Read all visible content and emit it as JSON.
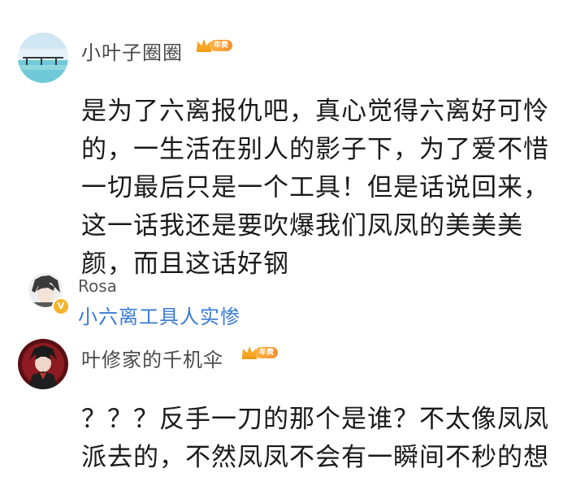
{
  "comments": [
    {
      "username": "小叶子圈圈",
      "badge": "年费",
      "body": "是为了六离报仇吧，真心觉得六离好可怜的，一生活在别人的影子下，为了爱不惜一切最后只是一个工具！但是话说回来，这一话我还是要吹爆我们凤凤的美美美颜，而且这话好钢"
    },
    {
      "username": "叶修家的千机伞",
      "badge": "年费",
      "body": "？？？反手一刀的那个是谁？不太像凤凤派去的，不然凤凤不会有一瞬间不秒的想"
    }
  ],
  "reply": {
    "username": "Rosa",
    "verify_mark": "V",
    "text": "小六离工具人实惨"
  }
}
